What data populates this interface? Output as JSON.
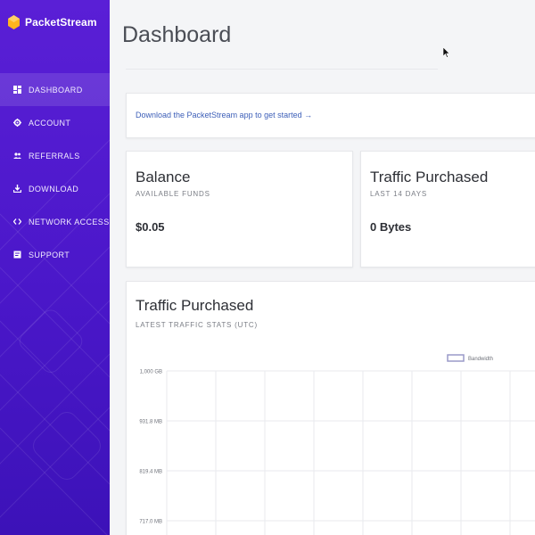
{
  "brand": {
    "name": "PacketStream"
  },
  "sidebar": {
    "items": [
      {
        "label": "DASHBOARD",
        "icon": "dashboard-icon",
        "active": true
      },
      {
        "label": "ACCOUNT",
        "icon": "gear-icon",
        "active": false
      },
      {
        "label": "REFERRALS",
        "icon": "users-icon",
        "active": false
      },
      {
        "label": "DOWNLOAD",
        "icon": "download-icon",
        "active": false
      },
      {
        "label": "NETWORK ACCESS",
        "icon": "code-icon",
        "active": false
      },
      {
        "label": "SUPPORT",
        "icon": "support-icon",
        "active": false
      }
    ]
  },
  "header": {
    "title": "Dashboard"
  },
  "banner": {
    "link_text": "Download the PacketStream app to get started →"
  },
  "balance": {
    "title": "Balance",
    "subtitle": "AVAILABLE FUNDS",
    "value": "$0.05"
  },
  "traffic_card": {
    "title": "Traffic Purchased",
    "subtitle": "LAST 14 DAYS",
    "value": "0 Bytes"
  },
  "traffic_chart": {
    "title": "Traffic Purchased",
    "subtitle": "LATEST TRAFFIC STATS (UTC)"
  },
  "colors": {
    "accent": "#5a1fd6",
    "link": "#3d5fb8",
    "legend": "#9a9ac9"
  },
  "chart_data": {
    "type": "line",
    "title": "Traffic Purchased",
    "subtitle": "LATEST TRAFFIC STATS (UTC)",
    "series": [
      {
        "name": "Bandwidth",
        "values": []
      }
    ],
    "y_ticks": [
      "1,000 GB",
      "931.8 MB",
      "819.4 MB",
      "717.0 MB"
    ],
    "grid": true,
    "legend": "top-right"
  }
}
